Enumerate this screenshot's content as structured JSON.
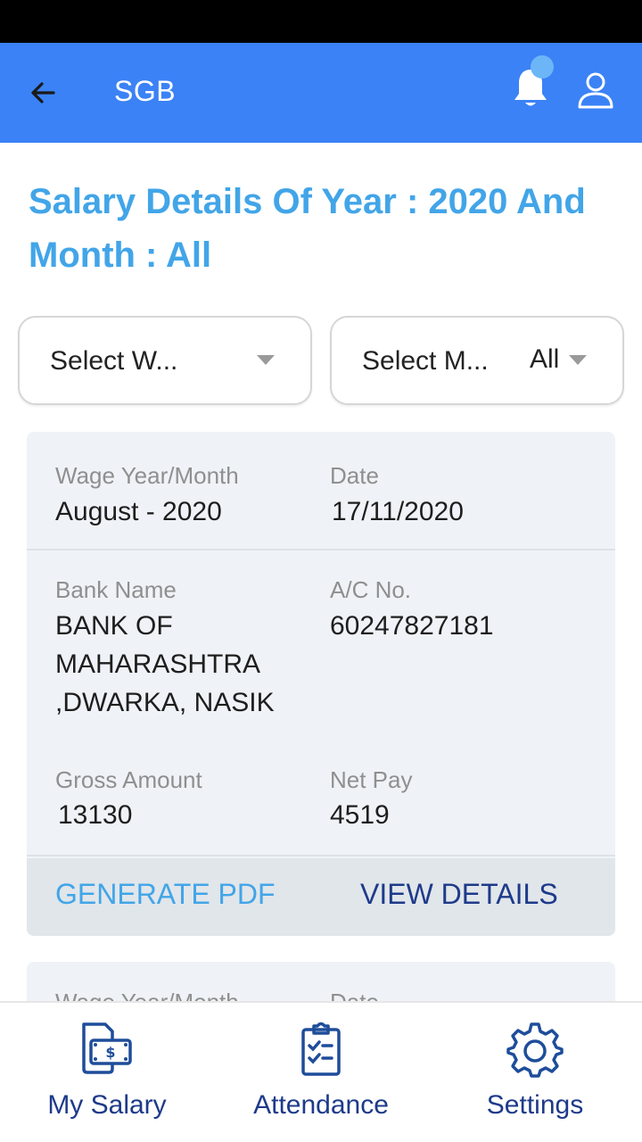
{
  "app_bar": {
    "title": "SGB",
    "back_icon": "arrow-left-icon",
    "notification_icon": "bell-icon",
    "profile_icon": "user-icon",
    "color": "#3b82f6"
  },
  "page": {
    "title": "Salary Details Of Year : 2020 And Month : All"
  },
  "filters": {
    "wage_year": {
      "label": "Select W...",
      "value": ""
    },
    "month": {
      "label": "Select M...",
      "value": "All"
    }
  },
  "salary_records": [
    {
      "wage_year_month_label": "Wage Year/Month",
      "wage_year_month": "August - 2020",
      "date_label": "Date",
      "date": "17/11/2020",
      "bank_name_label": "Bank Name",
      "bank_name": "BANK OF MAHARASHTRA ,DWARKA, NASIK",
      "ac_no_label": "A/C No.",
      "ac_no": "60247827181",
      "gross_amount_label": "Gross Amount",
      "gross_amount": "13130",
      "net_pay_label": "Net Pay",
      "net_pay": "4519",
      "generate_pdf": "GENERATE PDF",
      "view_details": "VIEW DETAILS"
    },
    {
      "wage_year_month_label": "Wage Year/Month",
      "date_label": "Date"
    }
  ],
  "bottom_nav": [
    {
      "label": "My Salary",
      "icon": "salary-icon"
    },
    {
      "label": "Attendance",
      "icon": "clipboard-checklist-icon"
    },
    {
      "label": "Settings",
      "icon": "gear-icon"
    }
  ],
  "colors": {
    "accent": "#42a5e8",
    "nav": "#1e3a8a",
    "card_bg": "#eff3f7"
  }
}
